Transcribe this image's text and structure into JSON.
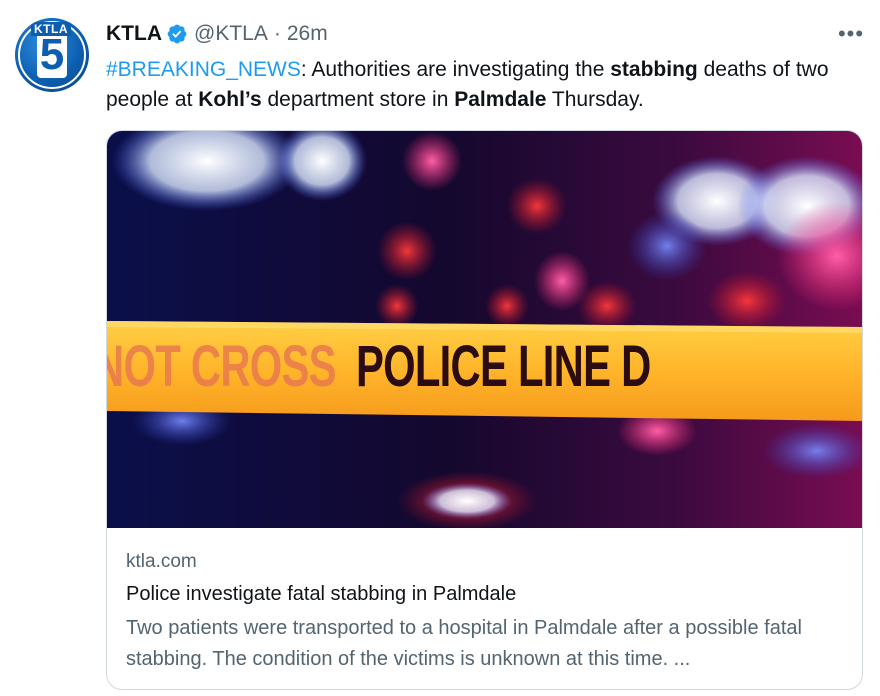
{
  "tweet": {
    "author_name": "KTLA",
    "handle": "@KTLA",
    "separator": "·",
    "time": "26m",
    "more_glyph": "•••",
    "avatar": {
      "top_text": "KTLA",
      "number": "5",
      "color": "#0c5fb0"
    },
    "text_parts": {
      "hashtag": "#BREAKING_NEWS",
      "t1": ": Authorities are investigating the ",
      "b1": "stabbing",
      "t2": " deaths of two people at ",
      "b2": "Kohl’s",
      "t3": " department store in ",
      "b3": "Palmdale",
      "t4": " Thursday."
    }
  },
  "card": {
    "image": {
      "tape_faded_text": "NOT CROSS",
      "tape_main_text": "POLICE LINE DO NOT CROSS",
      "tape_color": "#ffb02e"
    },
    "domain": "ktla.com",
    "title": "Police investigate fatal stabbing in Palmdale",
    "description": "Two patients were transported to a hospital in Palmdale after a possible fatal stabbing. The condition of the victims is unknown at this time. ..."
  },
  "colors": {
    "link": "#1d9bf0",
    "verified": "#1d9bf0",
    "secondary_text": "#536471"
  }
}
